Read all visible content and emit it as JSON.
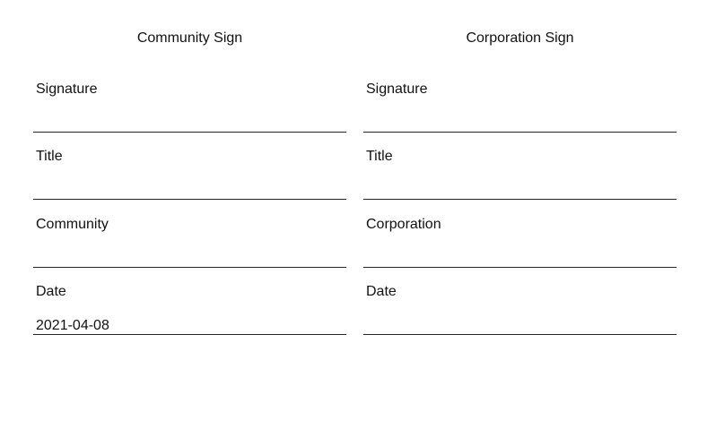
{
  "community": {
    "heading": "Community Sign",
    "signature_label": "Signature",
    "signature_value": "",
    "title_label": "Title",
    "title_value": "",
    "entity_label": "Community",
    "entity_value": "",
    "date_label": "Date",
    "date_value": "2021-04-08"
  },
  "corporation": {
    "heading": "Corporation Sign",
    "signature_label": "Signature",
    "signature_value": "",
    "title_label": "Title",
    "title_value": "",
    "entity_label": "Corporation",
    "entity_value": "",
    "date_label": "Date",
    "date_value": ""
  }
}
